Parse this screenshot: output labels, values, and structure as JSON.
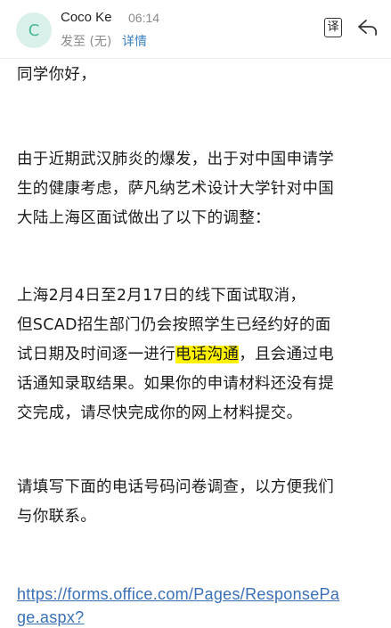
{
  "header": {
    "avatar_letter": "C",
    "sender_name": "Coco Ke",
    "time": "06:14",
    "to_text": "发至 (无)",
    "details_label": "详情",
    "translate_label": "译"
  },
  "body": {
    "greeting": "同学你好，",
    "p1_lines": [
      "由于近期武汉肺炎的爆发，出于对中国申请学",
      "生的健康考虑，萨凡纳艺术设计大学针对中国",
      "大陆上海区面试做出了以下的调整："
    ],
    "p2_line1": "上海2月4日至2月17日的线下面试取消，",
    "p2_line2": "但SCAD招生部门仍会按照学生已经约好的面",
    "p2_line3_pre": "试日期及时间逐一进行",
    "p2_line3_highlight": "电话沟通",
    "p2_line3_post": "，且会通过电",
    "p2_line4": "话通知录取结果。如果你的申请材料还没有提",
    "p2_line5": "交完成，请尽快完成你的网上材料提交。",
    "p3_lines": [
      "请填写下面的电话号码问卷调查，以方便我们",
      "与你联系。"
    ],
    "link_line1": "https://forms.office.com/Pages/ResponsePa",
    "link_line2": "ge.aspx?"
  },
  "colors": {
    "avatar_bg": "#d9f1ea",
    "avatar_fg": "#48b794",
    "link": "#3b6fb6",
    "highlight": "#fff200"
  }
}
